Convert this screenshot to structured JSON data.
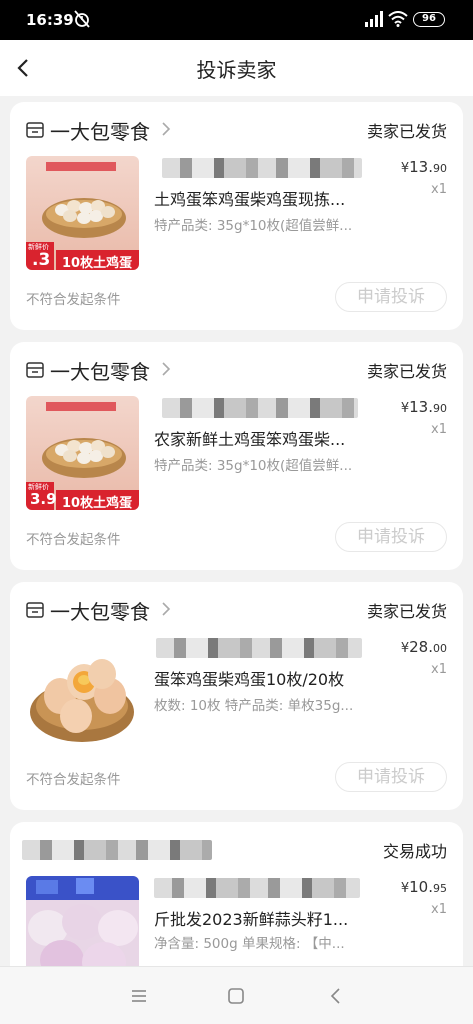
{
  "statusbar": {
    "time": "16:39",
    "battery": "96"
  },
  "header": {
    "title": "投诉卖家"
  },
  "orders": [
    {
      "shop_name": "一大包零食",
      "status": "卖家已发货",
      "product_name": "土鸡蛋笨鸡蛋柴鸡蛋现拣...",
      "spec": "特产品类: 35g*10枚(超值尝鲜...",
      "price_currency": "¥",
      "price_int": "13.",
      "price_dec": "90",
      "qty": "x1",
      "condition": "不符合发起条件",
      "button": "申请投诉",
      "thumb_badge": "10枚土鸡蛋",
      "thumb_price": ".3",
      "thumb_caption": "新鲜价"
    },
    {
      "shop_name": "一大包零食",
      "status": "卖家已发货",
      "product_name": "农家新鲜土鸡蛋笨鸡蛋柴...",
      "spec": "特产品类: 35g*10枚(超值尝鲜...",
      "price_currency": "¥",
      "price_int": "13.",
      "price_dec": "90",
      "qty": "x1",
      "condition": "不符合发起条件",
      "button": "申请投诉",
      "thumb_badge": "10枚土鸡蛋",
      "thumb_price": "3.9",
      "thumb_caption": "新鲜价"
    },
    {
      "shop_name": "一大包零食",
      "status": "卖家已发货",
      "product_name": "蛋笨鸡蛋柴鸡蛋10枚/20枚",
      "spec": "枚数: 10枚 特产品类: 单枚35g...",
      "price_currency": "¥",
      "price_int": "28.",
      "price_dec": "00",
      "qty": "x1",
      "condition": "不符合发起条件",
      "button": "申请投诉"
    },
    {
      "status": "交易成功",
      "product_name": "斤批发2023新鲜蒜头籽1...",
      "spec": "净含量: 500g 单果规格: 【中...",
      "price_currency": "¥",
      "price_int": "10.",
      "price_dec": "95",
      "qty": "x1"
    }
  ],
  "icons": {
    "back": "chevron-left-icon",
    "shop": "store-icon",
    "shop_arrow": "chevron-right-icon",
    "nav": [
      "menu-icon",
      "home-square-icon",
      "back-triangle-icon"
    ]
  },
  "colors": {
    "badge_red": "#d9232e",
    "accent_border": "#e8e8e8"
  }
}
